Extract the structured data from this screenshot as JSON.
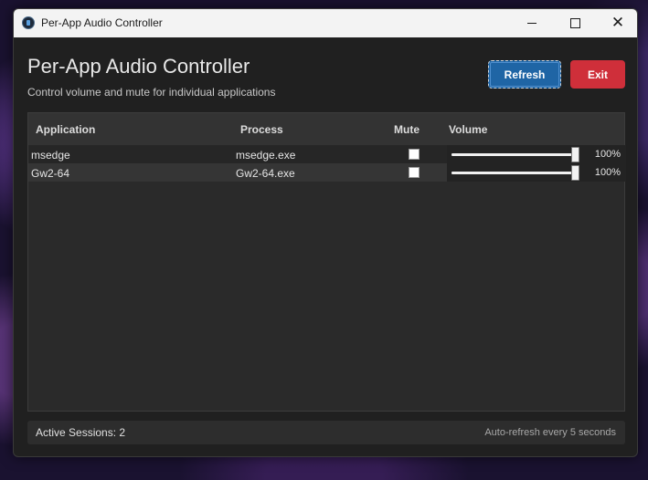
{
  "window": {
    "title": "Per-App Audio Controller",
    "icon": "speaker-icon"
  },
  "header": {
    "title": "Per-App Audio Controller",
    "subtitle": "Control volume and mute for individual applications"
  },
  "buttons": {
    "refresh_label": "Refresh",
    "exit_label": "Exit",
    "refresh_color": "#1f65a5",
    "exit_color": "#cf2f3a"
  },
  "table": {
    "columns": [
      "Application",
      "Process",
      "Mute",
      "Volume"
    ],
    "rows": [
      {
        "application": "msedge",
        "process": "msedge.exe",
        "muted": false,
        "volume": 100,
        "volume_label": "100%"
      },
      {
        "application": "Gw2-64",
        "process": "Gw2-64.exe",
        "muted": false,
        "volume": 100,
        "volume_label": "100%"
      }
    ]
  },
  "status": {
    "active_sessions": "Active Sessions: 2",
    "auto_refresh": "Auto-refresh every 5 seconds"
  }
}
